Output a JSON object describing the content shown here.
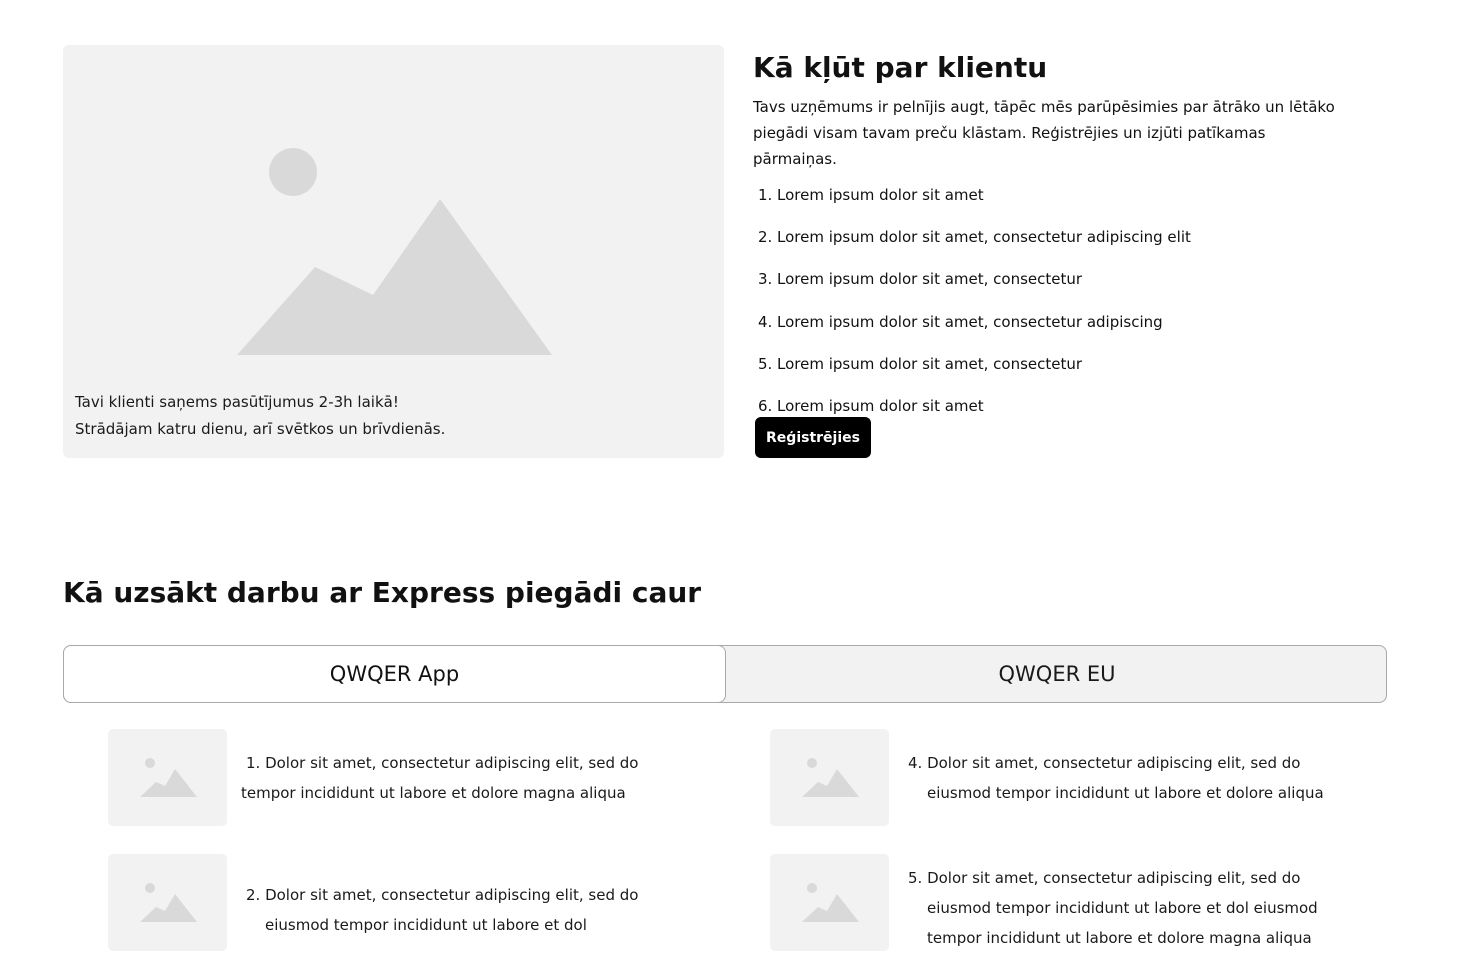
{
  "hero": {
    "image_icon": "image-placeholder-icon",
    "caption_line1": "Tavi klienti saņems pasūtījumus 2-3h laikā!",
    "caption_line2": "Strādājam katru dienu, arī svētkos un brīvdienās."
  },
  "become_client": {
    "title": "Kā kļūt par klientu",
    "description": "Tavs uzņēmums ir pelnījis augt, tāpēc mēs parūpēsimies par ātrāko un lētāko piegādi visam tavam preču klāstam. Reģistrējies un izjūti patīkamas pārmaiņas.",
    "steps": [
      {
        "num": "1.",
        "text": "Lorem ipsum dolor sit amet"
      },
      {
        "num": "2.",
        "text": "Lorem ipsum dolor sit amet, consectetur adipiscing elit"
      },
      {
        "num": "3.",
        "text": "Lorem ipsum dolor sit amet, consectetur"
      },
      {
        "num": "4.",
        "text": "Lorem ipsum dolor sit amet, consectetur adipiscing"
      },
      {
        "num": "5.",
        "text": "Lorem ipsum dolor sit amet, consectetur"
      },
      {
        "num": "6.",
        "text": "Lorem ipsum dolor sit amet"
      }
    ],
    "register_label": "Reģistrējies"
  },
  "getting_started": {
    "title": "Kā uzsākt darbu ar Express piegādi caur",
    "tabs": [
      {
        "label": "QWQER App",
        "active": true
      },
      {
        "label": "QWQER EU",
        "active": false
      }
    ],
    "items": [
      {
        "line1": "1. Dolor sit amet, consectetur adipiscing elit, sed do",
        "line2": "tempor incididunt ut labore et dolore magna aliqua"
      },
      {
        "line1": "2. Dolor sit amet, consectetur adipiscing elit, sed do",
        "line2": "eiusmod tempor incididunt ut labore et dol"
      },
      {
        "line1": "4. Dolor sit amet, consectetur adipiscing elit, sed do",
        "line2": "eiusmod tempor incididunt ut labore et dolore aliqua"
      },
      {
        "line1": "5. Dolor sit amet, consectetur adipiscing elit, sed do",
        "line2": "eiusmod tempor incididunt ut labore et dol  eiusmod",
        "line3": "tempor incididunt ut labore et dolore magna aliqua"
      }
    ]
  },
  "colors": {
    "placeholder_bg": "#f2f2f2",
    "placeholder_shape": "#d9d9d9",
    "button_bg": "#000000",
    "tab_border": "#a9a9a9"
  }
}
